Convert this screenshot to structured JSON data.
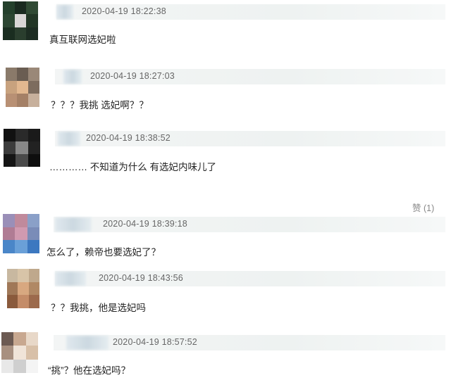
{
  "comments": [
    {
      "timestamp": "2020-04-19 18:22:38",
      "text": "真互联网选妃啦"
    },
    {
      "timestamp": "2020-04-19 18:27:03",
      "text": "？？？我挑 选妃啊？？"
    },
    {
      "timestamp": "2020-04-19 18:38:52",
      "text": "………… 不知道为什么 有选妃内味儿了",
      "like": "赞 (1)"
    },
    {
      "timestamp": "2020-04-19 18:39:18",
      "text": "怎么了，赖帝也要选妃了？"
    },
    {
      "timestamp": "2020-04-19 18:43:56",
      "text": "？？我挑，他是选妃吗"
    },
    {
      "timestamp": "2020-04-19 18:57:52",
      "text": "“挑”？他在选妃吗？"
    }
  ]
}
